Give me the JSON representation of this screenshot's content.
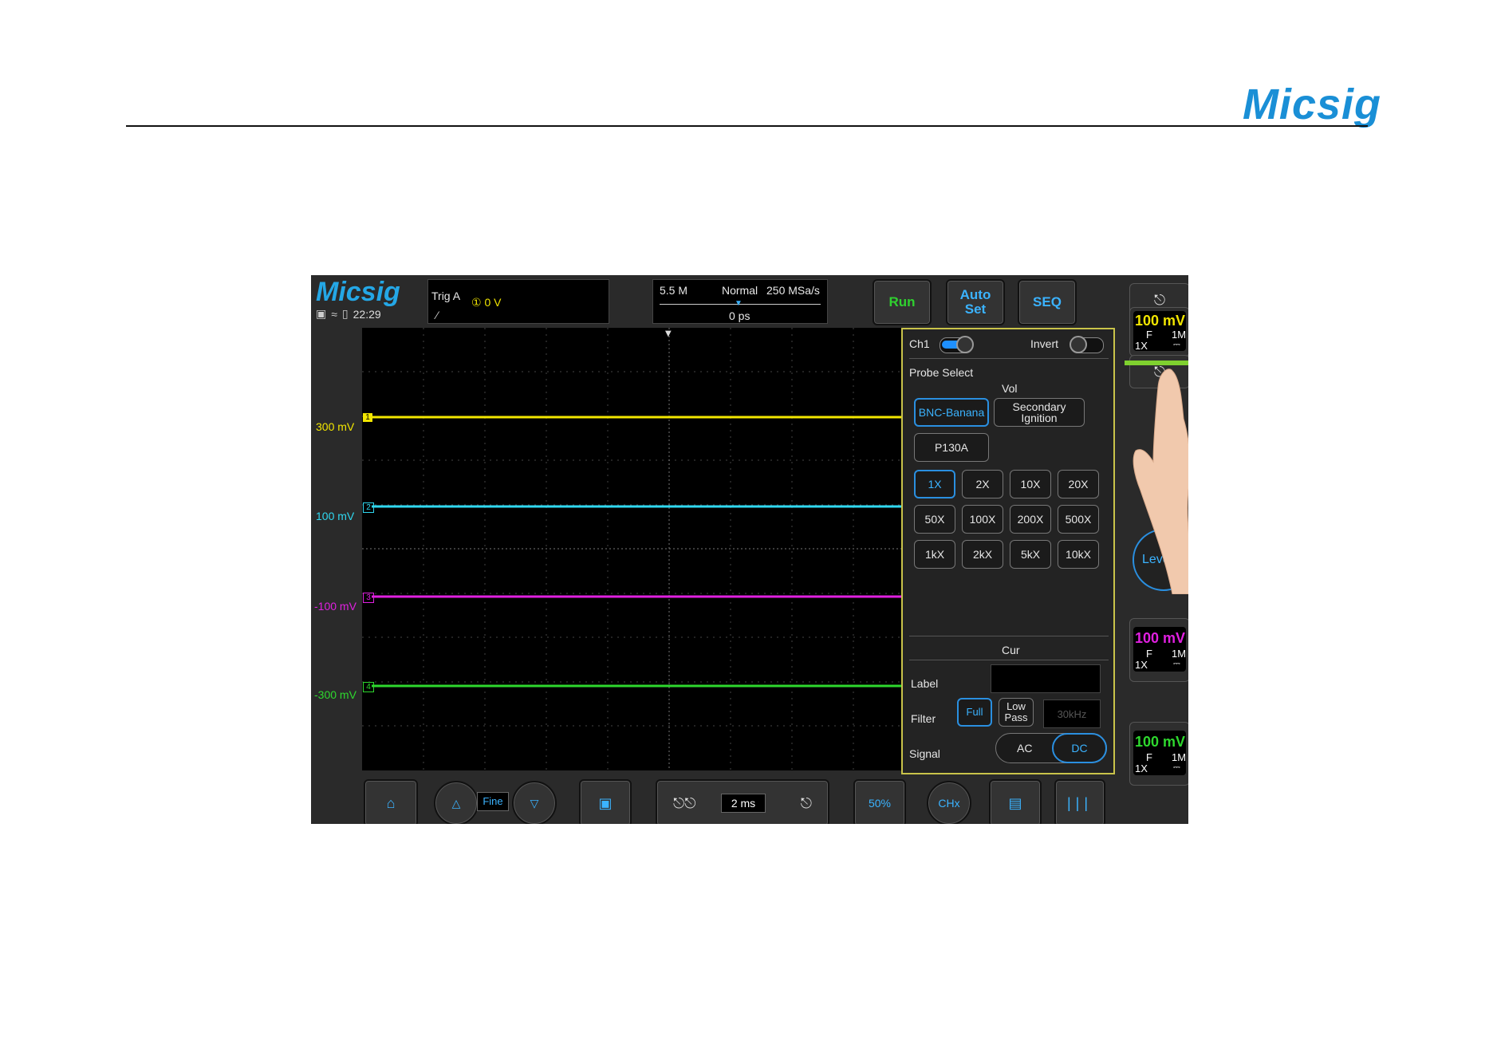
{
  "page": {
    "brand": "Micsig"
  },
  "scope": {
    "logo": "Micsig",
    "time": "22:29",
    "trigger": {
      "label": "Trig  A",
      "level": "① 0 V"
    },
    "acq": {
      "memory": "5.5 M",
      "mode": "Normal",
      "rate": "250 MSa/s",
      "position": "0 ps"
    },
    "buttons": {
      "run": "Run",
      "auto_line1": "Auto",
      "auto_line2": "Set",
      "seq": "SEQ"
    },
    "channels": [
      {
        "id": "1",
        "offset_label": "300 mV",
        "color": "#f2e600"
      },
      {
        "id": "2",
        "offset_label": "100 mV",
        "color": "#2fd8f0"
      },
      {
        "id": "3",
        "offset_label": "-100 mV",
        "color": "#e020e0"
      },
      {
        "id": "4",
        "offset_label": "-300 mV",
        "color": "#2ed82e"
      }
    ],
    "panel": {
      "ch_label": "Ch1",
      "invert_label": "Invert",
      "probe_select": "Probe Select",
      "vol": "Vol",
      "probes": [
        "BNC-Banana",
        "Secondary Ignition",
        "P130A"
      ],
      "attenuations": [
        "1X",
        "2X",
        "10X",
        "20X",
        "50X",
        "100X",
        "200X",
        "500X",
        "1kX",
        "2kX",
        "5kX",
        "10kX"
      ],
      "cur": "Cur",
      "label_field": "Label",
      "filter_label": "Filter",
      "filter_full": "Full",
      "filter_lowpass_1": "Low",
      "filter_lowpass_2": "Pass",
      "filter_freq": "30kHz",
      "signal_label": "Signal",
      "signal_ac": "AC",
      "signal_dc": "DC"
    },
    "right_channels": [
      {
        "volts": "100 mV",
        "coupling": "F",
        "impedance": "1M",
        "probe": "1X",
        "color": "#f2e600"
      },
      {
        "volts": "100 mV",
        "coupling": "F",
        "impedance": "1M",
        "probe": "1X",
        "color": "#e020e0"
      },
      {
        "volts": "100 mV",
        "coupling": "F",
        "impedance": "1M",
        "probe": "1X",
        "color": "#2ed82e"
      }
    ],
    "level_button": "Leve",
    "bottom": {
      "fine": "Fine",
      "timebase": "2 ms",
      "percent": "50%",
      "chx": "CHx"
    }
  },
  "colors": {
    "accent": "#3bb3ff",
    "run": "#2fd12f",
    "panel_border": "#c9c34a"
  }
}
